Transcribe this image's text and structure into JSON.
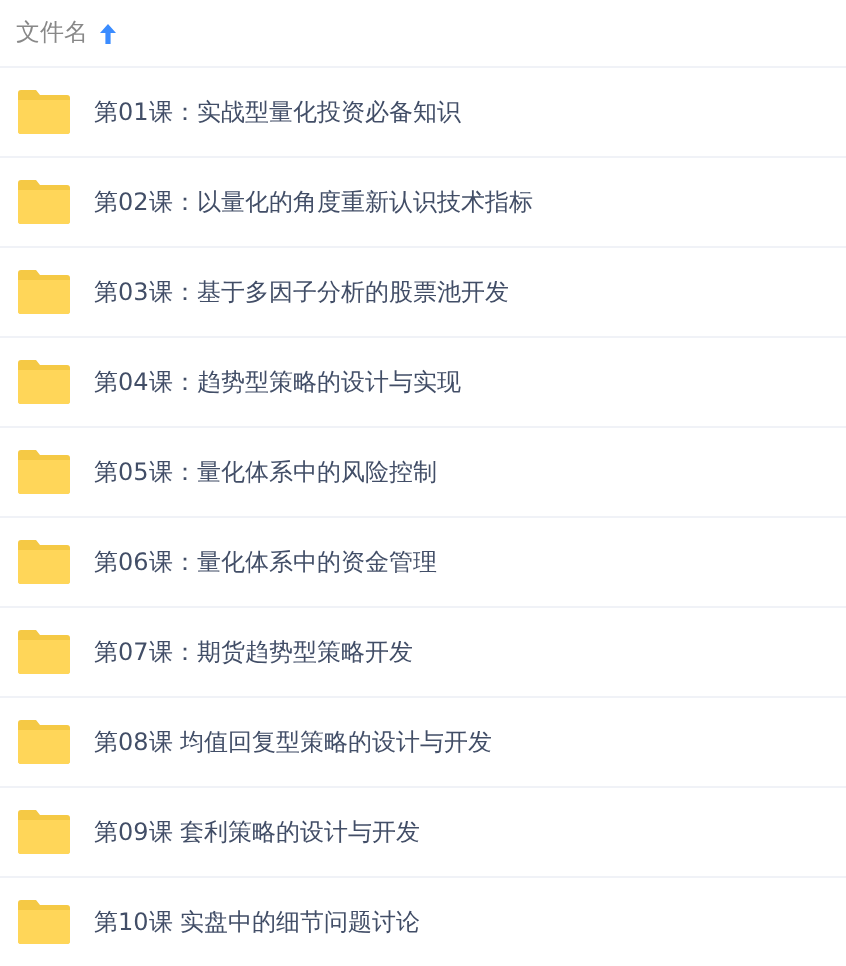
{
  "header": {
    "label": "文件名"
  },
  "files": [
    {
      "name": "第01课：实战型量化投资必备知识"
    },
    {
      "name": "第02课：以量化的角度重新认识技术指标"
    },
    {
      "name": "第03课：基于多因子分析的股票池开发"
    },
    {
      "name": "第04课：趋势型策略的设计与实现"
    },
    {
      "name": "第05课：量化体系中的风险控制"
    },
    {
      "name": "第06课：量化体系中的资金管理"
    },
    {
      "name": "第07课：期货趋势型策略开发"
    },
    {
      "name": "第08课 均值回复型策略的设计与开发"
    },
    {
      "name": "第09课 套利策略的设计与开发"
    },
    {
      "name": "第10课 实盘中的细节问题讨论"
    }
  ]
}
